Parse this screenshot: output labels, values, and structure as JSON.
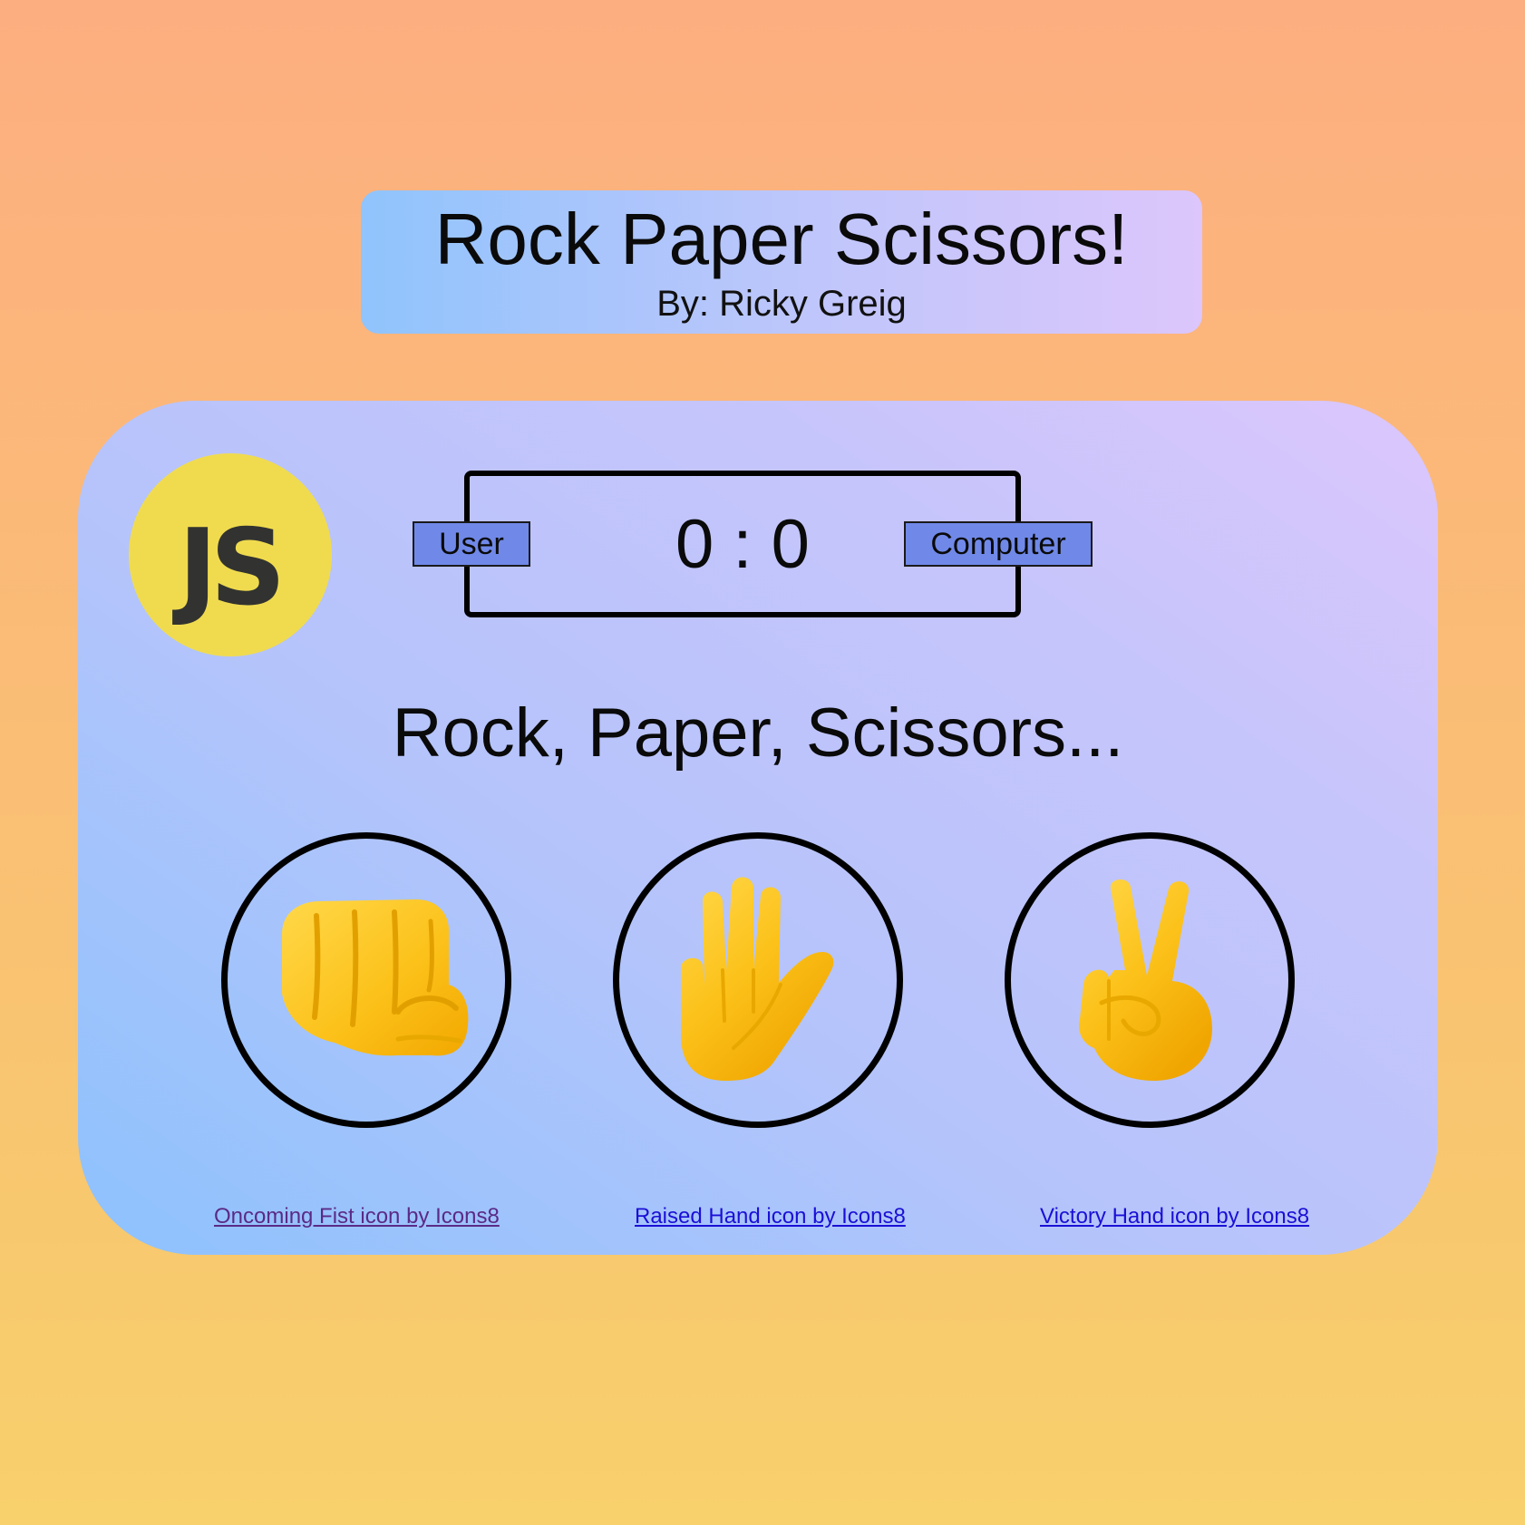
{
  "header": {
    "title": "Rock Paper Scissors!",
    "subtitle": "By: Ricky Greig"
  },
  "logo": {
    "text": "JS",
    "icon": "javascript-logo",
    "color": "#f0db4f"
  },
  "scoreboard": {
    "user_label": "User",
    "computer_label": "Computer",
    "score": "0 : 0",
    "badge_color": "#7089e8"
  },
  "prompt": "Rock, Paper, Scissors...",
  "choices": [
    {
      "name": "rock",
      "icon": "oncoming-fist-icon"
    },
    {
      "name": "paper",
      "icon": "raised-hand-icon"
    },
    {
      "name": "scissors",
      "icon": "victory-hand-icon"
    }
  ],
  "credits": {
    "rock": "Oncoming Fist icon by Icons8",
    "paper": "Raised Hand icon by Icons8",
    "scissors": "Victory Hand icon by Icons8"
  }
}
